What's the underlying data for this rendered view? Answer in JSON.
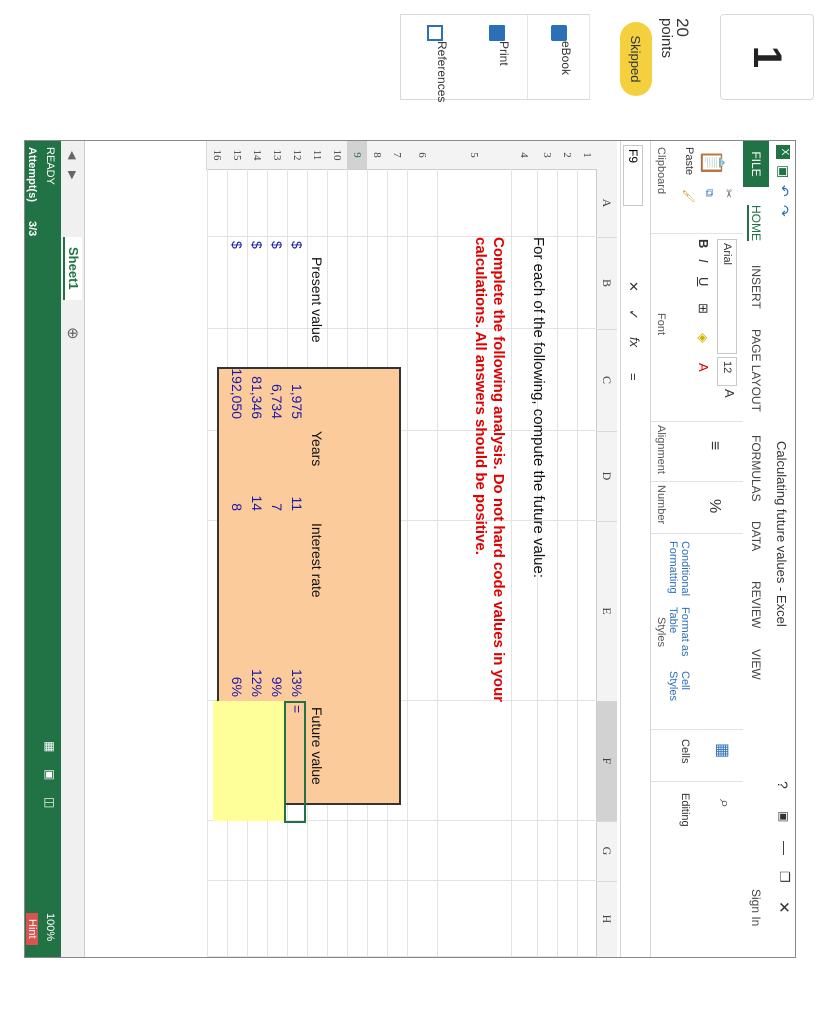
{
  "quiz": {
    "question_number": "1",
    "points_value": "20",
    "points_label": "points",
    "skipped_label": "Skipped",
    "resources": [
      {
        "label": "eBook",
        "icon": "book-icon"
      },
      {
        "label": "Print",
        "icon": "printer-icon"
      },
      {
        "label": "References",
        "icon": "copy-icon"
      }
    ]
  },
  "excel": {
    "title": "Calculating future values - Excel",
    "sign_in": "Sign In",
    "tabs": [
      "FILE",
      "HOME",
      "INSERT",
      "PAGE LAYOUT",
      "FORMULAS",
      "DATA",
      "REVIEW",
      "VIEW"
    ],
    "ribbon": {
      "paste": "Paste",
      "clipboard": "Clipboard",
      "font_name": "Arial",
      "font_size": "12",
      "font": "Font",
      "alignment": "Alignment",
      "number": "Number",
      "conditional": "Conditional Formatting",
      "format_as": "Format as Table",
      "cell_styles": "Cell Styles",
      "styles": "Styles",
      "cells": "Cells",
      "editing": "Editing"
    },
    "name_box": "F9",
    "formula": "=",
    "columns": [
      "A",
      "B",
      "C",
      "D",
      "E",
      "F",
      "G",
      "H"
    ],
    "rows": [
      "1",
      "2",
      "3",
      "4",
      "5",
      "6",
      "7",
      "8",
      "9",
      "10",
      "11",
      "12",
      "13",
      "14",
      "15",
      "16"
    ],
    "instruction": "For each of the following, compute the future value:",
    "warning": "Complete the following analysis. Do not hard code values in your calculations. All answers should be positive.",
    "table": {
      "headers": [
        "Present value",
        "Years",
        "Interest rate",
        "Future value"
      ],
      "rows": [
        {
          "cur": "$",
          "pv": "1,975",
          "years": "11",
          "rate": "13%",
          "fv": "="
        },
        {
          "cur": "$",
          "pv": "6,734",
          "years": "7",
          "rate": "9%",
          "fv": ""
        },
        {
          "cur": "$",
          "pv": "81,346",
          "years": "14",
          "rate": "12%",
          "fv": ""
        },
        {
          "cur": "$",
          "pv": "192,050",
          "years": "8",
          "rate": "6%",
          "fv": ""
        }
      ]
    },
    "sheet_tab": "Sheet1",
    "status": "READY",
    "zoom": "100%",
    "attempts_label": "Attempt(s)",
    "attempts_value": "3/3",
    "hint": "Hint"
  }
}
